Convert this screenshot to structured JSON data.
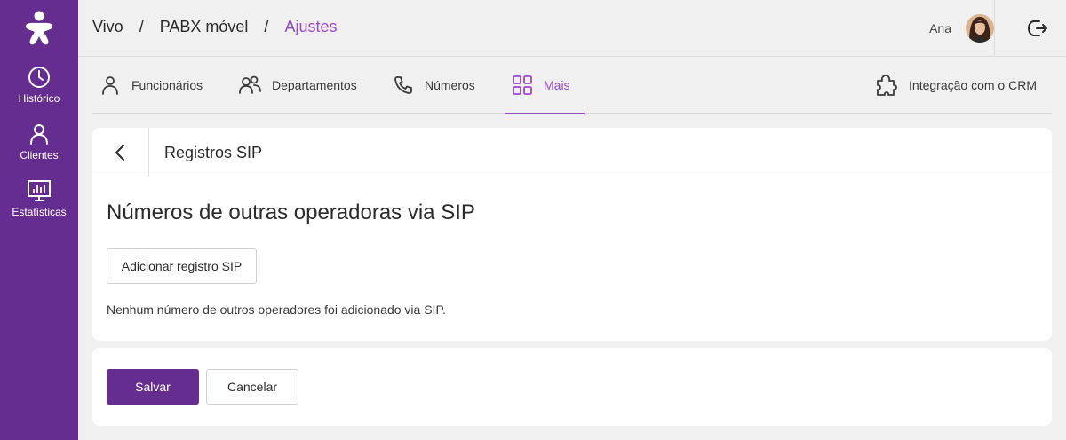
{
  "sidebar": {
    "logo_icon": "vivo-logo-icon",
    "items": [
      {
        "label": "Histórico",
        "icon": "clock-icon"
      },
      {
        "label": "Clientes",
        "icon": "person-icon"
      },
      {
        "label": "Estatísticas",
        "icon": "chart-monitor-icon"
      }
    ]
  },
  "header": {
    "breadcrumb": [
      "Vivo",
      "PABX móvel",
      "Ajustes"
    ],
    "separator": "/",
    "user_name": "Ana",
    "logout_icon": "logout-icon"
  },
  "tabs": [
    {
      "label": "Funcionários",
      "icon": "person-icon"
    },
    {
      "label": "Departamentos",
      "icon": "people-icon"
    },
    {
      "label": "Números",
      "icon": "phone-icon"
    },
    {
      "label": "Mais",
      "icon": "grid-icon",
      "active": true
    },
    {
      "label": "Integração com o CRM",
      "icon": "puzzle-icon"
    }
  ],
  "card": {
    "title": "Registros SIP",
    "section_title": "Números de outras operadoras via SIP",
    "add_button": "Adicionar registro SIP",
    "empty_text": "Nenhum número de outros operadores foi adicionado via SIP."
  },
  "actions": {
    "save": "Salvar",
    "cancel": "Cancelar"
  },
  "colors": {
    "brand": "#662d91",
    "accent": "#9b4ac7",
    "background": "#f0f0f0"
  }
}
